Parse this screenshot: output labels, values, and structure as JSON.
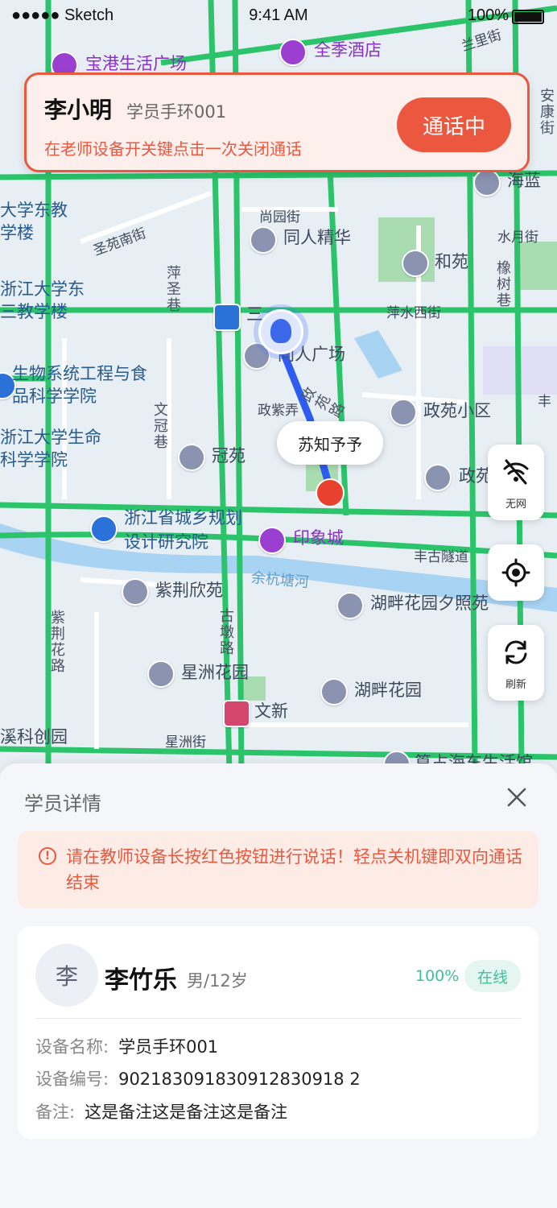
{
  "status_bar": {
    "signal": "●●●●● Sketch",
    "time": "9:41 AM",
    "battery": "100%"
  },
  "map": {
    "pois": [
      "宝港生活广场",
      "全季酒店",
      "同人精华",
      "和苑",
      "三",
      "同人广场",
      "政苑小区",
      "冠苑",
      "印象城",
      "紫荆欣苑",
      "湖畔花园夕照苑",
      "星洲花园",
      "湖畔花园",
      "文新",
      "浙江省城乡规划设计研究院",
      "生物系统工程与食品科学学院",
      "浙江大学生命科学学院",
      "浙江大学东三教学楼",
      "大学东教学楼",
      "溪科创园",
      "海蓝",
      "政苑",
      "篁占海东生活馆"
    ],
    "roads": [
      "圣苑南街",
      "尚园街",
      "水月街",
      "萍水西街",
      "政紫弄",
      "丰古隧道",
      "星洲街",
      "兰里街",
      "丰"
    ],
    "river": "余杭塘河",
    "vertical_labels": [
      "萍圣巷",
      "文冠巷",
      "紫荆花路",
      "古墩路",
      "橡树巷",
      "政苑路",
      "安康街"
    ],
    "route_end_label": "苏知予予"
  },
  "call_card": {
    "name": "李小明",
    "device": "学员手环001",
    "hint": "在老师设备开关键点击一次关闭通话",
    "button": "通话中"
  },
  "side_buttons": {
    "no_network": {
      "label": "无网",
      "icon": "wifi-off-icon"
    },
    "locate": {
      "icon": "locate-icon"
    },
    "refresh": {
      "label": "刷新",
      "icon": "refresh-icon"
    }
  },
  "sheet": {
    "title": "学员详情",
    "notice": "请在教师设备长按红色按钮进行说话！轻点关机键即双向通话结束",
    "student": {
      "avatar_char": "李",
      "name": "李竹乐",
      "meta": "男/12岁",
      "battery": "100%",
      "status": "在线"
    },
    "fields": [
      {
        "key": "设备名称:",
        "value": "学员手环001"
      },
      {
        "key": "设备编号:",
        "value": "902183091830912830918 2"
      },
      {
        "key": "备注:",
        "value": "这是备注这是备注这是备注"
      }
    ]
  },
  "colors": {
    "accent_red": "#e8593f",
    "online_green": "#3fc09a",
    "road_green": "#2bc46a",
    "route_blue": "#2e5bf0"
  }
}
